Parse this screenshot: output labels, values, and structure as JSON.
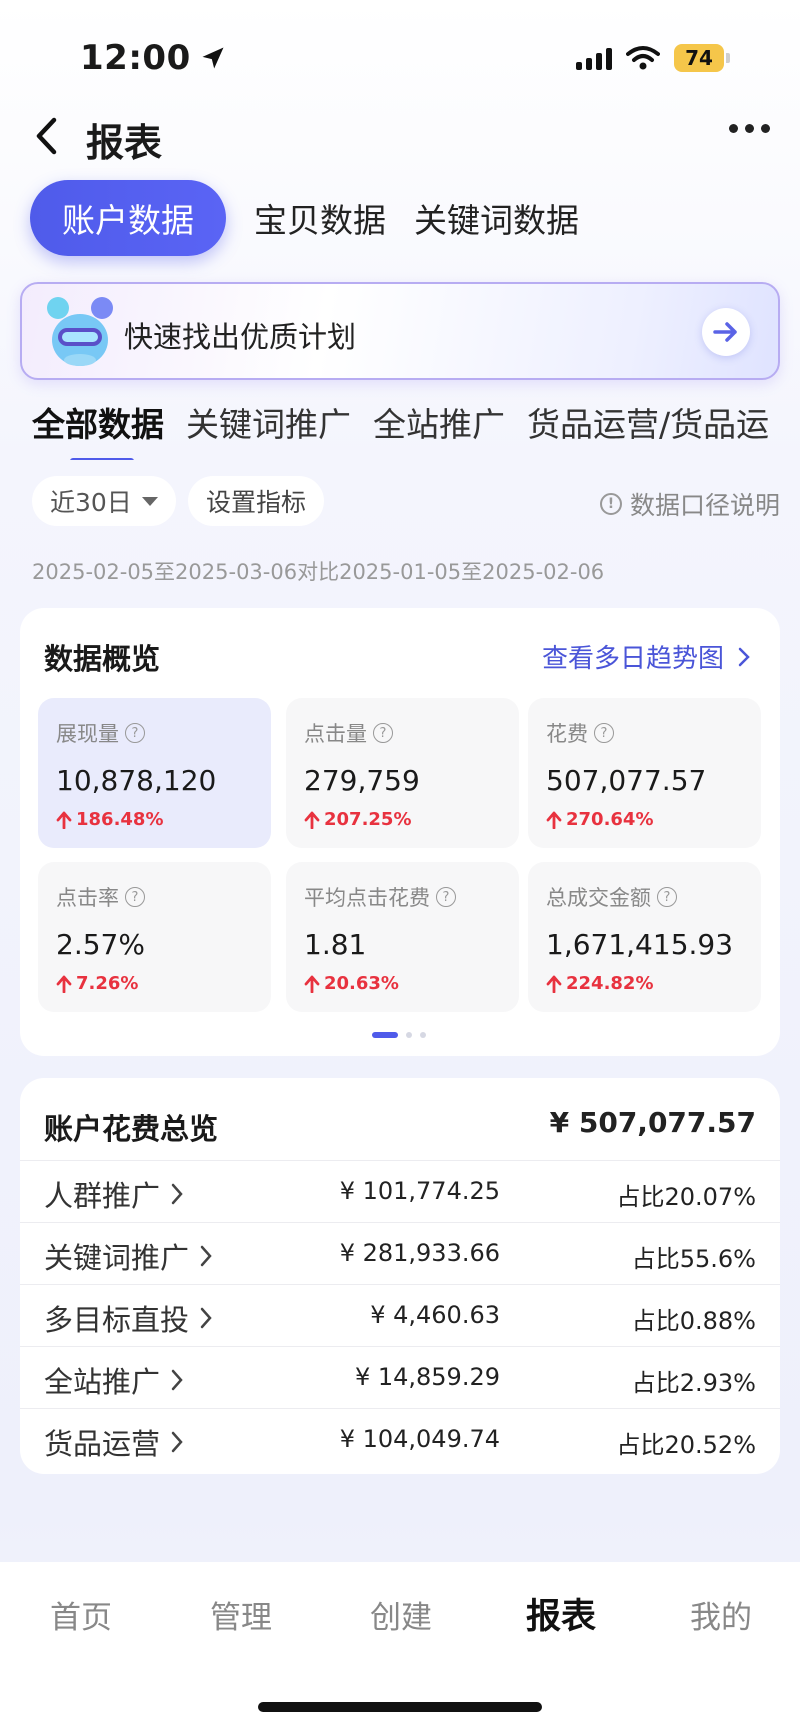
{
  "status_bar": {
    "time": "12:00",
    "battery": "74"
  },
  "nav": {
    "title": "报表"
  },
  "top_tabs": [
    "账户数据",
    "宝贝数据",
    "关键词数据"
  ],
  "banner": {
    "text": "快速找出优质计划"
  },
  "sub_tabs": [
    "全部数据",
    "关键词推广",
    "全站推广",
    "货品运营/货品运"
  ],
  "filters": {
    "date_range": "近30日",
    "set_metrics": "设置指标",
    "data_note": "数据口径说明"
  },
  "date_text": "2025-02-05至2025-03-06对比2025-01-05至2025-02-06",
  "overview": {
    "title": "数据概览",
    "trend_link": "查看多日趋势图",
    "metrics": [
      {
        "label": "展现量",
        "value": "10,878,120",
        "change": "186.48%"
      },
      {
        "label": "点击量",
        "value": "279,759",
        "change": "207.25%"
      },
      {
        "label": "花费",
        "value": "507,077.57",
        "change": "270.64%"
      },
      {
        "label": "点击率",
        "value": "2.57%",
        "change": "7.26%"
      },
      {
        "label": "平均点击花费",
        "value": "1.81",
        "change": "20.63%"
      },
      {
        "label": "总成交金额",
        "value": "1,671,415.93",
        "change": "224.82%"
      }
    ]
  },
  "spend": {
    "title": "账户花费总览",
    "total": "¥ 507,077.57",
    "rows": [
      {
        "name": "人群推广",
        "amount": "¥ 101,774.25",
        "ratio": "占比20.07%"
      },
      {
        "name": "关键词推广",
        "amount": "¥ 281,933.66",
        "ratio": "占比55.6%"
      },
      {
        "name": "多目标直投",
        "amount": "¥ 4,460.63",
        "ratio": "占比0.88%"
      },
      {
        "name": "全站推广",
        "amount": "¥ 14,859.29",
        "ratio": "占比2.93%"
      },
      {
        "name": "货品运营",
        "amount": "¥ 104,049.74",
        "ratio": "占比20.52%"
      }
    ]
  },
  "bottom_nav": [
    "首页",
    "管理",
    "创建",
    "报表",
    "我的"
  ],
  "colors": {
    "accent": "#4f5bea",
    "up": "#e8323f",
    "link": "#4a55d8"
  }
}
